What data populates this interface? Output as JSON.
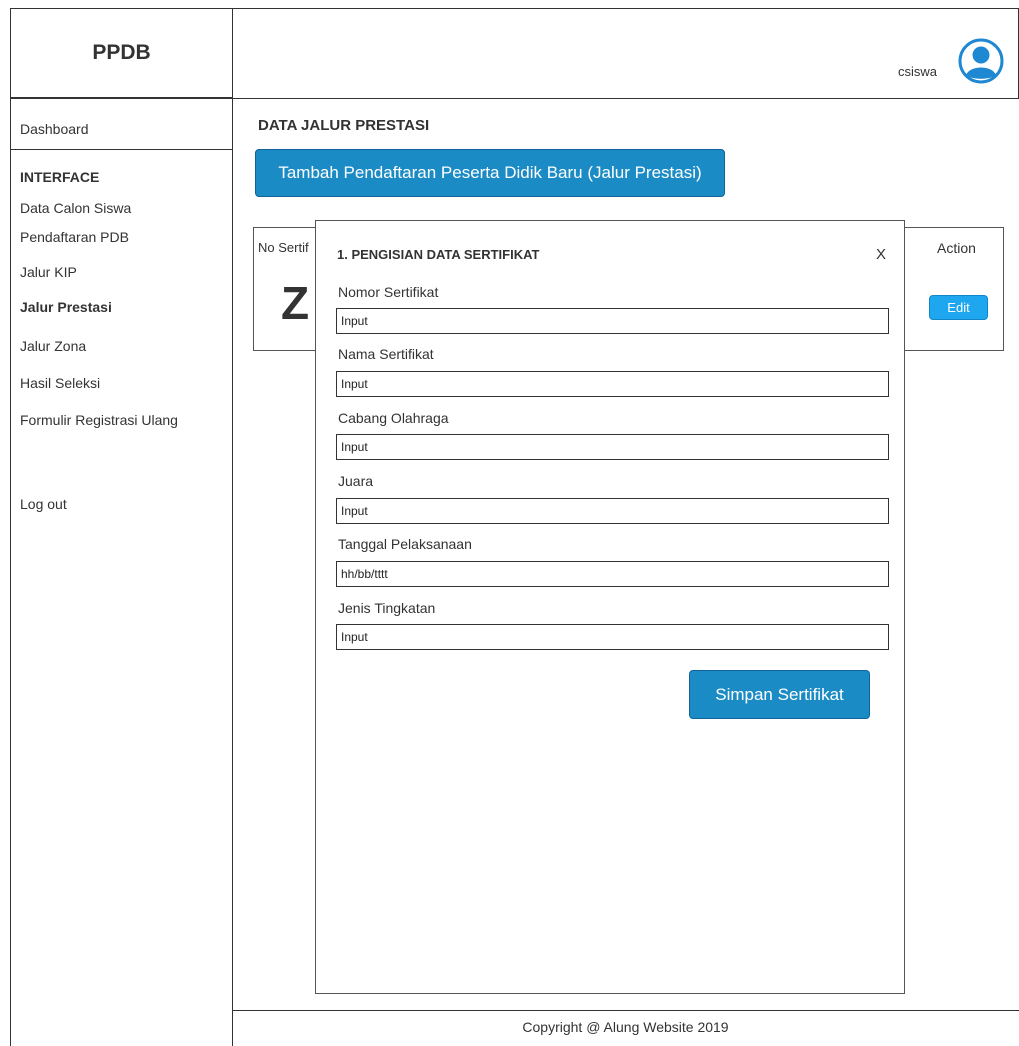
{
  "app": {
    "logo": "PPDB"
  },
  "header": {
    "username": "csiswa"
  },
  "sidebar": {
    "dashboard": "Dashboard",
    "section_heading": "INTERFACE",
    "items": [
      {
        "label": "Data Calon Siswa"
      },
      {
        "label": "Pendaftaran PDB"
      },
      {
        "label": "Jalur KIP"
      },
      {
        "label": "Jalur Prestasi"
      },
      {
        "label": "Jalur Zona"
      },
      {
        "label": "Hasil Seleksi"
      },
      {
        "label": "Formulir Registrasi Ulang"
      }
    ],
    "logout": "Log out"
  },
  "main": {
    "title": "DATA JALUR PRESTASI",
    "add_button": "Tambah Pendaftaran Peserta Didik Baru (Jalur Prestasi)",
    "table": {
      "col_no": "No Sertif",
      "col_action": "Action",
      "row_glyph": "Z",
      "edit_label": "Edit"
    }
  },
  "modal": {
    "title": "1. PENGISIAN DATA SERTIFIKAT",
    "close": "X",
    "fields": [
      {
        "label": "Nomor Sertifikat",
        "value": "Input"
      },
      {
        "label": "Nama Sertifikat",
        "value": "Input"
      },
      {
        "label": "Cabang Olahraga",
        "value": "Input"
      },
      {
        "label": "Juara",
        "value": "Input"
      },
      {
        "label": "Tanggal Pelaksanaan",
        "value": "hh/bb/tttt"
      },
      {
        "label": "Jenis Tingkatan",
        "value": "Input"
      }
    ],
    "save_button": "Simpan Sertifikat"
  },
  "footer": {
    "copyright": "Copyright @ Alung Website 2019"
  },
  "colors": {
    "primary_button": "#1b8bc5",
    "edit_button": "#1ea7ef"
  }
}
